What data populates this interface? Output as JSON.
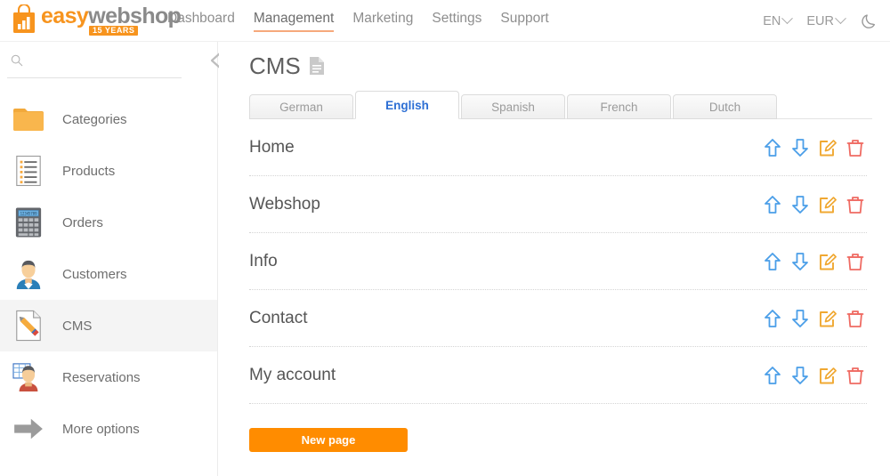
{
  "header": {
    "logo": {
      "part1": "easy",
      "part2": "webshop",
      "badge": "15 YEARS",
      "icon": "shopping-bag-chart-icon"
    },
    "nav": [
      {
        "label": "Dashboard",
        "active": false
      },
      {
        "label": "Management",
        "active": true
      },
      {
        "label": "Marketing",
        "active": false
      },
      {
        "label": "Settings",
        "active": false
      },
      {
        "label": "Support",
        "active": false
      }
    ],
    "language_selector": "EN",
    "currency_selector": "EUR",
    "theme_toggle_icon": "moon-icon"
  },
  "sidebar": {
    "search": {
      "value": "",
      "placeholder": "",
      "icon": "search-icon"
    },
    "collapse_icon": "chevron-left-icon",
    "items": [
      {
        "label": "Categories",
        "icon": "folder-icon",
        "active": false
      },
      {
        "label": "Products",
        "icon": "list-document-icon",
        "active": false
      },
      {
        "label": "Orders",
        "icon": "calculator-icon",
        "active": false
      },
      {
        "label": "Customers",
        "icon": "user-avatar-icon",
        "active": false
      },
      {
        "label": "CMS",
        "icon": "document-pencil-icon",
        "active": true
      },
      {
        "label": "Reservations",
        "icon": "calendar-person-icon",
        "active": false
      },
      {
        "label": "More options",
        "icon": "arrow-right-icon",
        "active": false
      }
    ]
  },
  "main": {
    "title": "CMS",
    "title_icon": "document-icon",
    "tabs": [
      {
        "label": "German",
        "active": false
      },
      {
        "label": "English",
        "active": true
      },
      {
        "label": "Spanish",
        "active": false
      },
      {
        "label": "French",
        "active": false
      },
      {
        "label": "Dutch",
        "active": false
      }
    ],
    "pages": [
      {
        "name": "Home"
      },
      {
        "name": "Webshop"
      },
      {
        "name": "Info"
      },
      {
        "name": "Contact"
      },
      {
        "name": "My account"
      }
    ],
    "row_actions": [
      {
        "name": "move-up-icon",
        "title": "Move up"
      },
      {
        "name": "move-down-icon",
        "title": "Move down"
      },
      {
        "name": "edit-icon",
        "title": "Edit"
      },
      {
        "name": "delete-icon",
        "title": "Delete"
      }
    ],
    "new_page_button": "New page"
  },
  "colors": {
    "brand_orange": "#f7941e",
    "button_orange": "#ff8c00",
    "active_tab_blue": "#2d6fd4",
    "arrow_blue": "#4a9ee8",
    "edit_orange": "#f0a832",
    "delete_red": "#ef6b63",
    "nav_underline": "#f6a97c"
  }
}
